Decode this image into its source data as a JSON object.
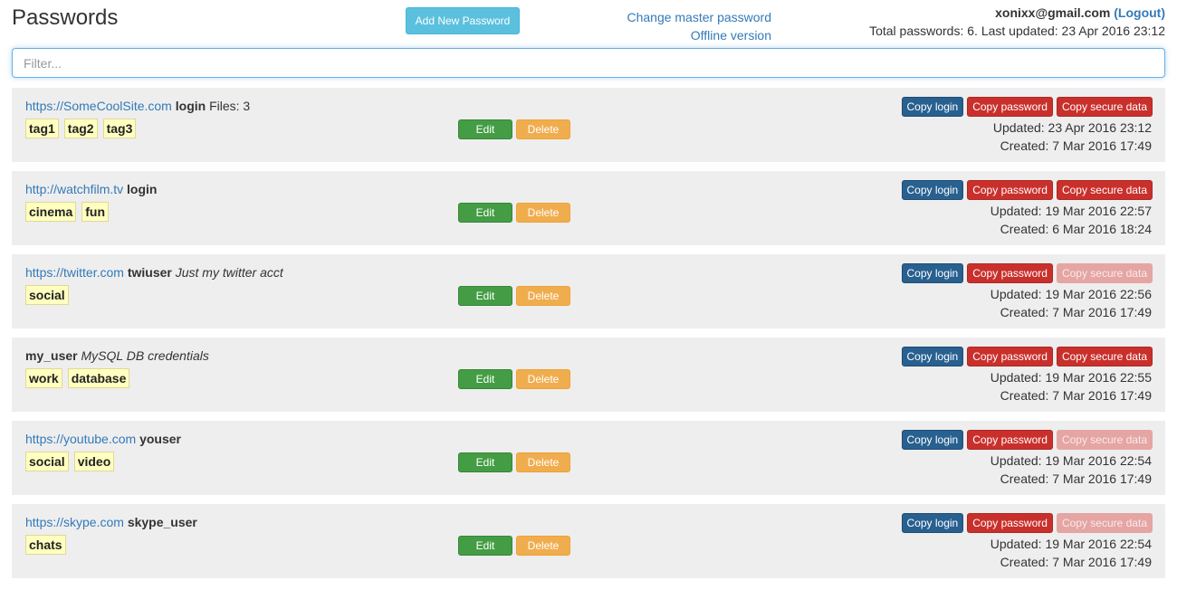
{
  "header": {
    "title": "Passwords",
    "add_button": "Add New Password",
    "change_master_link": "Change master password",
    "offline_link": "Offline version",
    "user_email": "xonixx@gmail.com",
    "logout_label": "(Logout)",
    "summary": "Total passwords: 6. Last updated: 23 Apr 2016 23:12"
  },
  "filter": {
    "placeholder": "Filter...",
    "value": ""
  },
  "buttons": {
    "edit": "Edit",
    "delete": "Delete",
    "copy_login": "Copy login",
    "copy_password": "Copy password",
    "copy_secure": "Copy secure data"
  },
  "entries": [
    {
      "site": "https://SomeCoolSite.com",
      "login": "login",
      "note": "",
      "files": "Files: 3",
      "tags": [
        "tag1",
        "tag2",
        "tag3"
      ],
      "secure_enabled": true,
      "updated": "Updated: 23 Apr 2016 23:12",
      "created": "Created: 7 Mar 2016 17:49"
    },
    {
      "site": "http://watchfilm.tv",
      "login": "login",
      "note": "",
      "files": "",
      "tags": [
        "cinema",
        "fun"
      ],
      "secure_enabled": true,
      "updated": "Updated: 19 Mar 2016 22:57",
      "created": "Created: 6 Mar 2016 18:24"
    },
    {
      "site": "https://twitter.com",
      "login": "twiuser",
      "note": "Just my twitter acct",
      "files": "",
      "tags": [
        "social"
      ],
      "secure_enabled": false,
      "updated": "Updated: 19 Mar 2016 22:56",
      "created": "Created: 7 Mar 2016 17:49"
    },
    {
      "site": "",
      "login": "my_user",
      "note": "MySQL DB credentials",
      "files": "",
      "tags": [
        "work",
        "database"
      ],
      "secure_enabled": true,
      "updated": "Updated: 19 Mar 2016 22:55",
      "created": "Created: 7 Mar 2016 17:49"
    },
    {
      "site": "https://youtube.com",
      "login": "youser",
      "note": "",
      "files": "",
      "tags": [
        "social",
        "video"
      ],
      "secure_enabled": false,
      "updated": "Updated: 19 Mar 2016 22:54",
      "created": "Created: 7 Mar 2016 17:49"
    },
    {
      "site": "https://skype.com",
      "login": "skype_user",
      "note": "",
      "files": "",
      "tags": [
        "chats"
      ],
      "secure_enabled": false,
      "updated": "Updated: 19 Mar 2016 22:54",
      "created": "Created: 7 Mar 2016 17:49"
    }
  ]
}
